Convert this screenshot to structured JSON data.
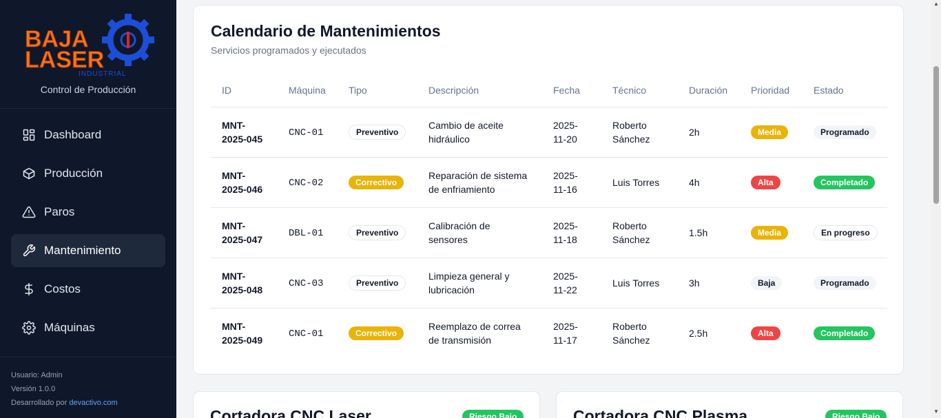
{
  "sidebar": {
    "logo_text_line1": "BAJA",
    "logo_text_line2": "LASER",
    "logo_text_line3": "INDUSTRIAL",
    "subtitle": "Control de Producción",
    "items": [
      {
        "label": "Dashboard",
        "icon": "dashboard-icon"
      },
      {
        "label": "Producción",
        "icon": "package-icon"
      },
      {
        "label": "Paros",
        "icon": "warning-icon"
      },
      {
        "label": "Mantenimiento",
        "icon": "wrench-icon",
        "active": true
      },
      {
        "label": "Costos",
        "icon": "dollar-icon"
      },
      {
        "label": "Máquinas",
        "icon": "gear-icon"
      }
    ],
    "footer": {
      "user": "Usuario: Admin",
      "version": "Versión 1.0.0",
      "dev_prefix": "Desarrollado por ",
      "dev_link": "devactivo.com"
    }
  },
  "calendar": {
    "title": "Calendario de Mantenimientos",
    "subtitle": "Servicios programados y ejecutados",
    "columns": [
      "ID",
      "Máquina",
      "Tipo",
      "Descripción",
      "Fecha",
      "Técnico",
      "Duración",
      "Prioridad",
      "Estado"
    ],
    "rows": [
      {
        "id": "MNT-\n2025-045",
        "machine": "CNC-01",
        "type": "Preventivo",
        "desc": "Cambio de aceite hidráulico",
        "date": "2025-\n11-20",
        "tech": "Roberto Sánchez",
        "duration": "2h",
        "priority": "Media",
        "status": "Programado"
      },
      {
        "id": "MNT-\n2025-046",
        "machine": "CNC-02",
        "type": "Correctivo",
        "desc": "Reparación de sistema de enfriamiento",
        "date": "2025-\n11-16",
        "tech": "Luis Torres",
        "duration": "4h",
        "priority": "Alta",
        "status": "Completado"
      },
      {
        "id": "MNT-\n2025-047",
        "machine": "DBL-01",
        "type": "Preventivo",
        "desc": "Calibración de sensores",
        "date": "2025-\n11-18",
        "tech": "Roberto Sánchez",
        "duration": "1.5h",
        "priority": "Media",
        "status": "En progreso"
      },
      {
        "id": "MNT-\n2025-048",
        "machine": "CNC-03",
        "type": "Preventivo",
        "desc": "Limpieza general y lubricación",
        "date": "2025-\n11-22",
        "tech": "Luis Torres",
        "duration": "3h",
        "priority": "Baja",
        "status": "Programado"
      },
      {
        "id": "MNT-\n2025-049",
        "machine": "CNC-01",
        "type": "Correctivo",
        "desc": "Reemplazo de correa de transmisión",
        "date": "2025-\n11-17",
        "tech": "Roberto Sánchez",
        "duration": "2.5h",
        "priority": "Alta",
        "status": "Completado"
      }
    ]
  },
  "machine_cards": [
    {
      "title": "Cortadora CNC Laser",
      "badge": "Riesgo Bajo"
    },
    {
      "title": "Cortadora CNC Plasma",
      "badge": "Riesgo Bajo"
    }
  ],
  "colors": {
    "sidebar_bg": "#0f172a",
    "accent_orange": "#f97316",
    "accent_blue": "#1d4ed8",
    "yellow": "#eab308",
    "red": "#ef4444",
    "green": "#22c55e"
  }
}
